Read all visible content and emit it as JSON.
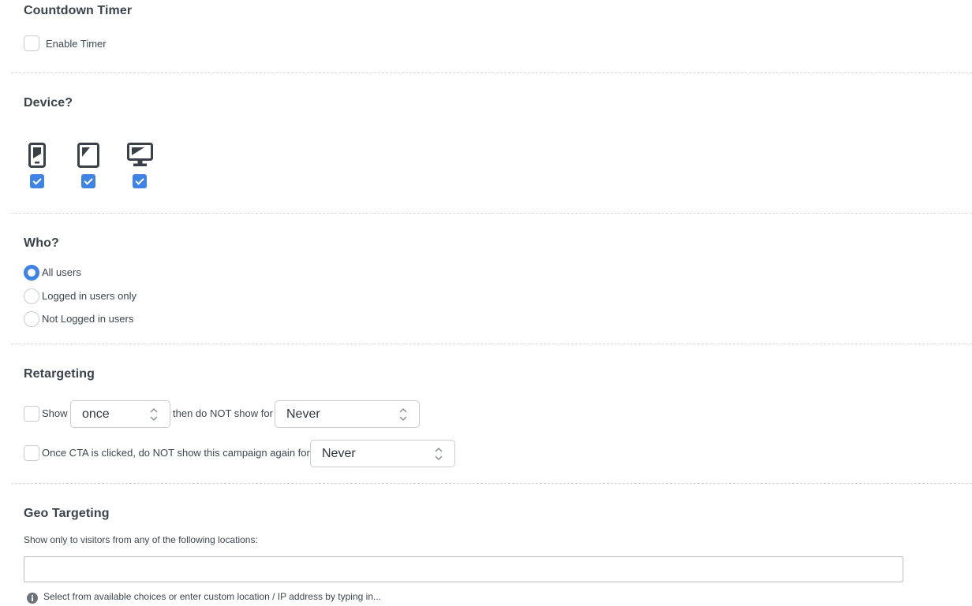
{
  "countdown": {
    "title": "Countdown Timer",
    "enable_label": "Enable Timer",
    "enabled": false
  },
  "device": {
    "title": "Device?",
    "options": [
      {
        "icon": "mobile-phone-icon",
        "checked": true
      },
      {
        "icon": "tablet-icon",
        "checked": true
      },
      {
        "icon": "desktop-monitor-icon",
        "checked": true
      }
    ]
  },
  "who": {
    "title": "Who?",
    "options": [
      {
        "label": "All users",
        "selected": true
      },
      {
        "label": "Logged in users only",
        "selected": false
      },
      {
        "label": "Not Logged in users",
        "selected": false
      }
    ]
  },
  "retargeting": {
    "title": "Retargeting",
    "show_label": "Show",
    "show_value": "once",
    "then_label": "then do NOT show for",
    "then_value": "Never",
    "cta_label": "Once CTA is clicked, do NOT show this campaign again for",
    "cta_value": "Never"
  },
  "geo": {
    "title": "Geo Targeting",
    "description": "Show only to visitors from any of the following locations:",
    "input_value": "",
    "hint": "Select from available choices or enter custom location / IP address by typing in..."
  },
  "colors": {
    "accent": "#3f83e6",
    "icon": "#3a4048",
    "divider": "#d6d8db"
  }
}
